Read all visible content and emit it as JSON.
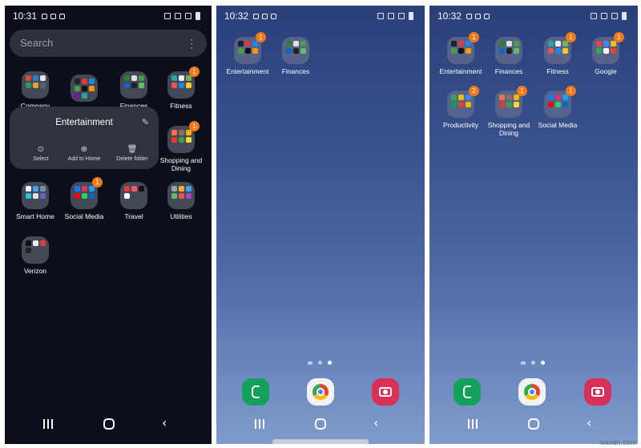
{
  "colors": {
    "badge": "#f07a1c",
    "drawer_bg": "#0b0f1a",
    "popup_bg": "#2f333d",
    "wallpaper": "#3a548f"
  },
  "screens": [
    {
      "time": "10:31",
      "search_placeholder": "Search",
      "folders": [
        {
          "label": "Company",
          "badge": ""
        },
        {
          "label": "",
          "badge": ""
        },
        {
          "label": "Finances",
          "badge": ""
        },
        {
          "label": "Fitness",
          "badge": "1"
        },
        {
          "label": "Shopping and Dining",
          "badge": "1"
        },
        {
          "label": "Smart Home",
          "badge": ""
        },
        {
          "label": "Social Media",
          "badge": "1"
        },
        {
          "label": "Travel",
          "badge": ""
        },
        {
          "label": "Utilities",
          "badge": ""
        },
        {
          "label": "Verizon",
          "badge": ""
        }
      ],
      "popup": {
        "title": "Entertainment",
        "actions": [
          {
            "label": "Select",
            "icon": "check-circle-icon"
          },
          {
            "label": "Add to Home",
            "icon": "add-home-icon"
          },
          {
            "label": "Delete folder",
            "icon": "trash-icon"
          }
        ]
      }
    },
    {
      "time": "10:32",
      "folders": [
        {
          "label": "Entertainment",
          "badge": "1"
        },
        {
          "label": "Finances",
          "badge": ""
        }
      ],
      "dock": [
        "phone-icon",
        "chrome-icon",
        "camera-icon"
      ]
    },
    {
      "time": "10:32",
      "folders": [
        {
          "label": "Entertainment",
          "badge": "1"
        },
        {
          "label": "Finances",
          "badge": ""
        },
        {
          "label": "Fitness",
          "badge": "1"
        },
        {
          "label": "Google",
          "badge": "1"
        },
        {
          "label": "Productivity",
          "badge": "2"
        },
        {
          "label": "Shopping and Dining",
          "badge": "1"
        },
        {
          "label": "Social Media",
          "badge": "1"
        }
      ],
      "dock": [
        "phone-icon",
        "chrome-icon",
        "camera-icon"
      ]
    }
  ],
  "watermark": "wsxdn.com"
}
